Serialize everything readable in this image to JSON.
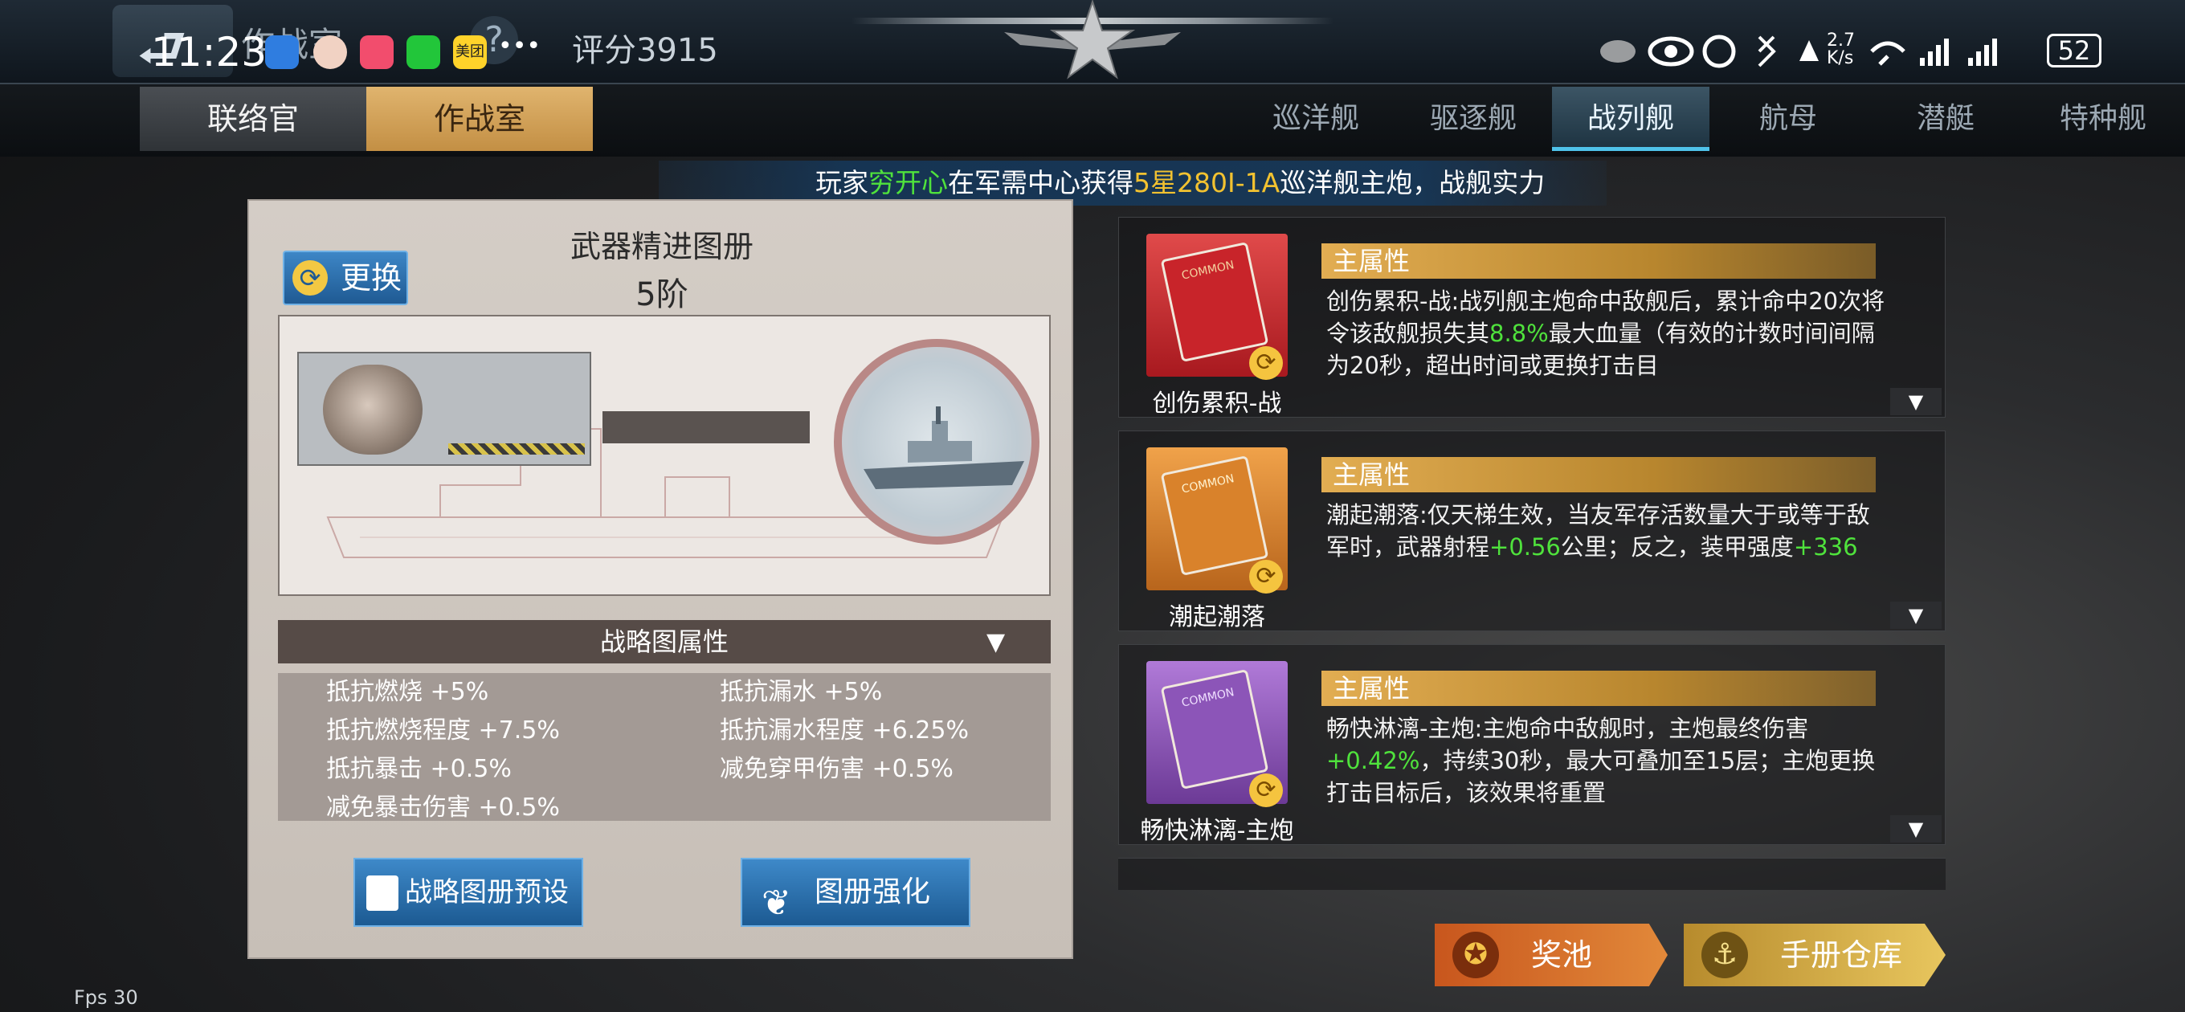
{
  "status_bar": {
    "time": "11:23",
    "battery": "52",
    "net_speed": "2.7 K/s",
    "apps": [
      "app-blue",
      "app-avatar",
      "app-pink",
      "wechat",
      "meituan"
    ],
    "meituan_label": "美团",
    "more": "•••"
  },
  "header": {
    "page_title": "作战室",
    "back_glyph": "⮐",
    "help_glyph": "?",
    "score": "评分3915"
  },
  "main_tabs": [
    "联络官",
    "作战室"
  ],
  "ship_tabs": [
    "巡洋舰",
    "驱逐舰",
    "战列舰",
    "航母",
    "潜艇",
    "特种舰"
  ],
  "ticker": {
    "prefix": "玩家",
    "player": "穷开心",
    "middle": "在军需中心获得",
    "item": "5星280Ⅰ-1A",
    "suffix": "巡洋舰主炮，战舰实力‍"
  },
  "left_panel": {
    "title": "武器精进图册",
    "level": "5阶",
    "swap_label": "更换",
    "attr_header": "战略图属性",
    "attributes": [
      [
        "抵抗燃烧 +5%",
        "抵抗漏水 +5%"
      ],
      [
        "抵抗燃烧程度 +7.5%",
        "抵抗漏水程度 +6.25%"
      ],
      [
        "抵抗暴击 +0.5%",
        "减免穿甲伤害 +0.5%"
      ],
      [
        "减免暴击伤害 +0.5%",
        ""
      ]
    ],
    "preset_label": "战略图册预设",
    "enhance_label": "图册强化"
  },
  "cards": [
    {
      "name": "创伤累积-战",
      "main_label": "主属性",
      "color": "#c8242a",
      "desc_a": "创伤累积-战:战列舰主炮命中敌舰后，累计命中20次将令该敌舰损失其",
      "desc_g": "8.8%",
      "desc_b": "最大血量（有效的计数时间间隔为20秒，超出时间或更换打击目"
    },
    {
      "name": "潮起潮落",
      "main_label": "主属性",
      "color": "#d9822b",
      "desc_a": "潮起潮落:仅天梯生效，当友军存活数量大于或等于敌军时，武器射程",
      "desc_g": "+0.56",
      "desc_b": "公里；反之，装甲强度",
      "desc_g2": "+336"
    },
    {
      "name": "畅快淋漓-主炮",
      "main_label": "主属性",
      "color": "#8c55b8",
      "desc_a": "畅快淋漓-主炮:主炮命中敌舰时，主炮最终伤害",
      "desc_g": "+0.42%",
      "desc_b": "，持续30秒，最大可叠加至15层；主炮更换打击目标后，该效果将重置"
    }
  ],
  "bottom_buttons": {
    "pool": "奖池",
    "warehouse": "手册仓库"
  },
  "fps": "Fps 30",
  "book_tag": "COMMON"
}
